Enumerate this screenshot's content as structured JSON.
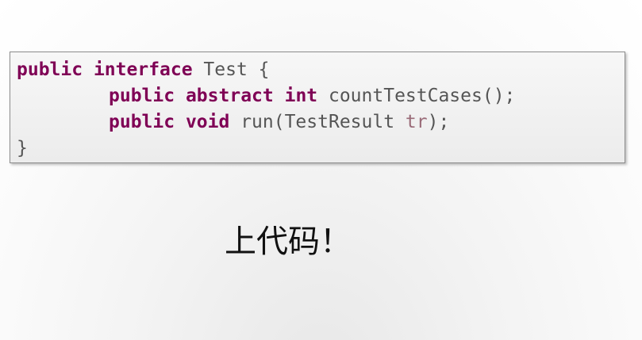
{
  "code_block": {
    "line1": {
      "kw1": "public",
      "kw2": "interface",
      "rest": " Test {"
    },
    "line2": {
      "kw1": "public",
      "kw2": "abstract",
      "kw3": "int",
      "rest": " countTestCases();"
    },
    "line3": {
      "kw1": "public",
      "kw2": "void",
      "rest_before_param": " run(TestResult ",
      "param": "tr",
      "rest_after_param": ");"
    },
    "line4": {
      "text": "}"
    }
  },
  "caption": "上代码！",
  "colors": {
    "keyword": "#7f0055",
    "plain_text": "#555555",
    "parameter": "#9a6b78"
  }
}
